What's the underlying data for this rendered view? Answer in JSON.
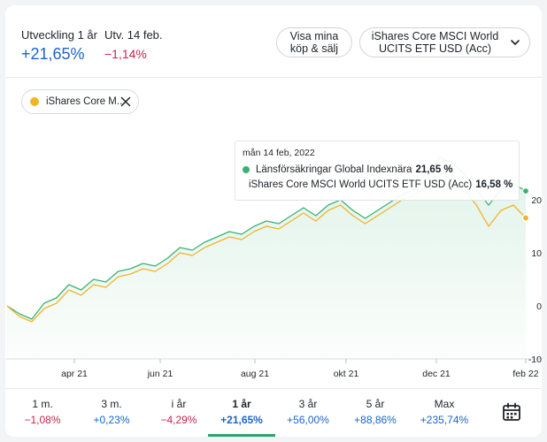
{
  "header": {
    "development_label": "Utveckling 1 år",
    "development_value": "+21,65%",
    "date_label": "Utv. 14 feb.",
    "date_value": "−1,14%",
    "trades_button": [
      "Visa mina",
      "köp & sälj"
    ],
    "fund_selector": [
      "iShares Core MSCI World",
      "UCITS ETF USD (Acc)"
    ]
  },
  "chip": {
    "label": "iShares Core M..."
  },
  "tooltip": {
    "date": "mån 14 feb, 2022",
    "rows": [
      {
        "name": "Länsförsäkringar Global Indexnära",
        "value": "21,65 %",
        "color": "#3ab273"
      },
      {
        "name": "iShares Core MSCI World UCITS ETF USD (Acc)",
        "value": "16,58 %",
        "color": "#f0b42b"
      }
    ]
  },
  "chart_data": {
    "type": "line",
    "x_ticks": [
      "apr 21",
      "jun 21",
      "aug 21",
      "okt 21",
      "dec 21",
      "feb 22"
    ],
    "y_ticks": [
      "20",
      "10",
      "0",
      "-10"
    ],
    "ylim": [
      -10,
      30
    ],
    "grid": false,
    "series": [
      {
        "name": "Länsförsäkringar Global Indexnära",
        "color": "#3ab273",
        "values": [
          0,
          -1.5,
          -2.5,
          0.5,
          1.5,
          4,
          3,
          5,
          4.5,
          6.5,
          7,
          8,
          7.5,
          9,
          11,
          10.5,
          12,
          13,
          14,
          13.5,
          15,
          16,
          15.5,
          17,
          18.5,
          17,
          19,
          20,
          18,
          16.5,
          18,
          19.5,
          21,
          22,
          24,
          28,
          27,
          25,
          22,
          19,
          22,
          23,
          21.65
        ]
      },
      {
        "name": "iShares Core MSCI World UCITS ETF USD (Acc)",
        "color": "#f0b42b",
        "values": [
          0,
          -2,
          -3,
          -0.5,
          0.5,
          3,
          2,
          4,
          3.5,
          5.5,
          6,
          7,
          6.5,
          8,
          10,
          9.5,
          11,
          12,
          13,
          12.5,
          14,
          15,
          14.5,
          16,
          17.5,
          16,
          18,
          19,
          17,
          15.5,
          17,
          18.5,
          20,
          21,
          22.5,
          25,
          24,
          22,
          19,
          15,
          18,
          19,
          16.58
        ]
      }
    ]
  },
  "tabs": [
    {
      "label": "1 m.",
      "value": "−1,08%",
      "sign": "neg"
    },
    {
      "label": "3 m.",
      "value": "+0,23%",
      "sign": "pos"
    },
    {
      "label": "i år",
      "value": "−4,29%",
      "sign": "neg"
    },
    {
      "label": "1 år",
      "value": "+21,65%",
      "sign": "pos",
      "active": true
    },
    {
      "label": "3 år",
      "value": "+56,00%",
      "sign": "pos"
    },
    {
      "label": "5 år",
      "value": "+88,86%",
      "sign": "pos"
    },
    {
      "label": "Max",
      "value": "+235,74%",
      "sign": "pos"
    }
  ],
  "icons": {
    "calendar": "calendar-icon",
    "close": "close-icon",
    "chevron": "chevron-down-icon"
  }
}
